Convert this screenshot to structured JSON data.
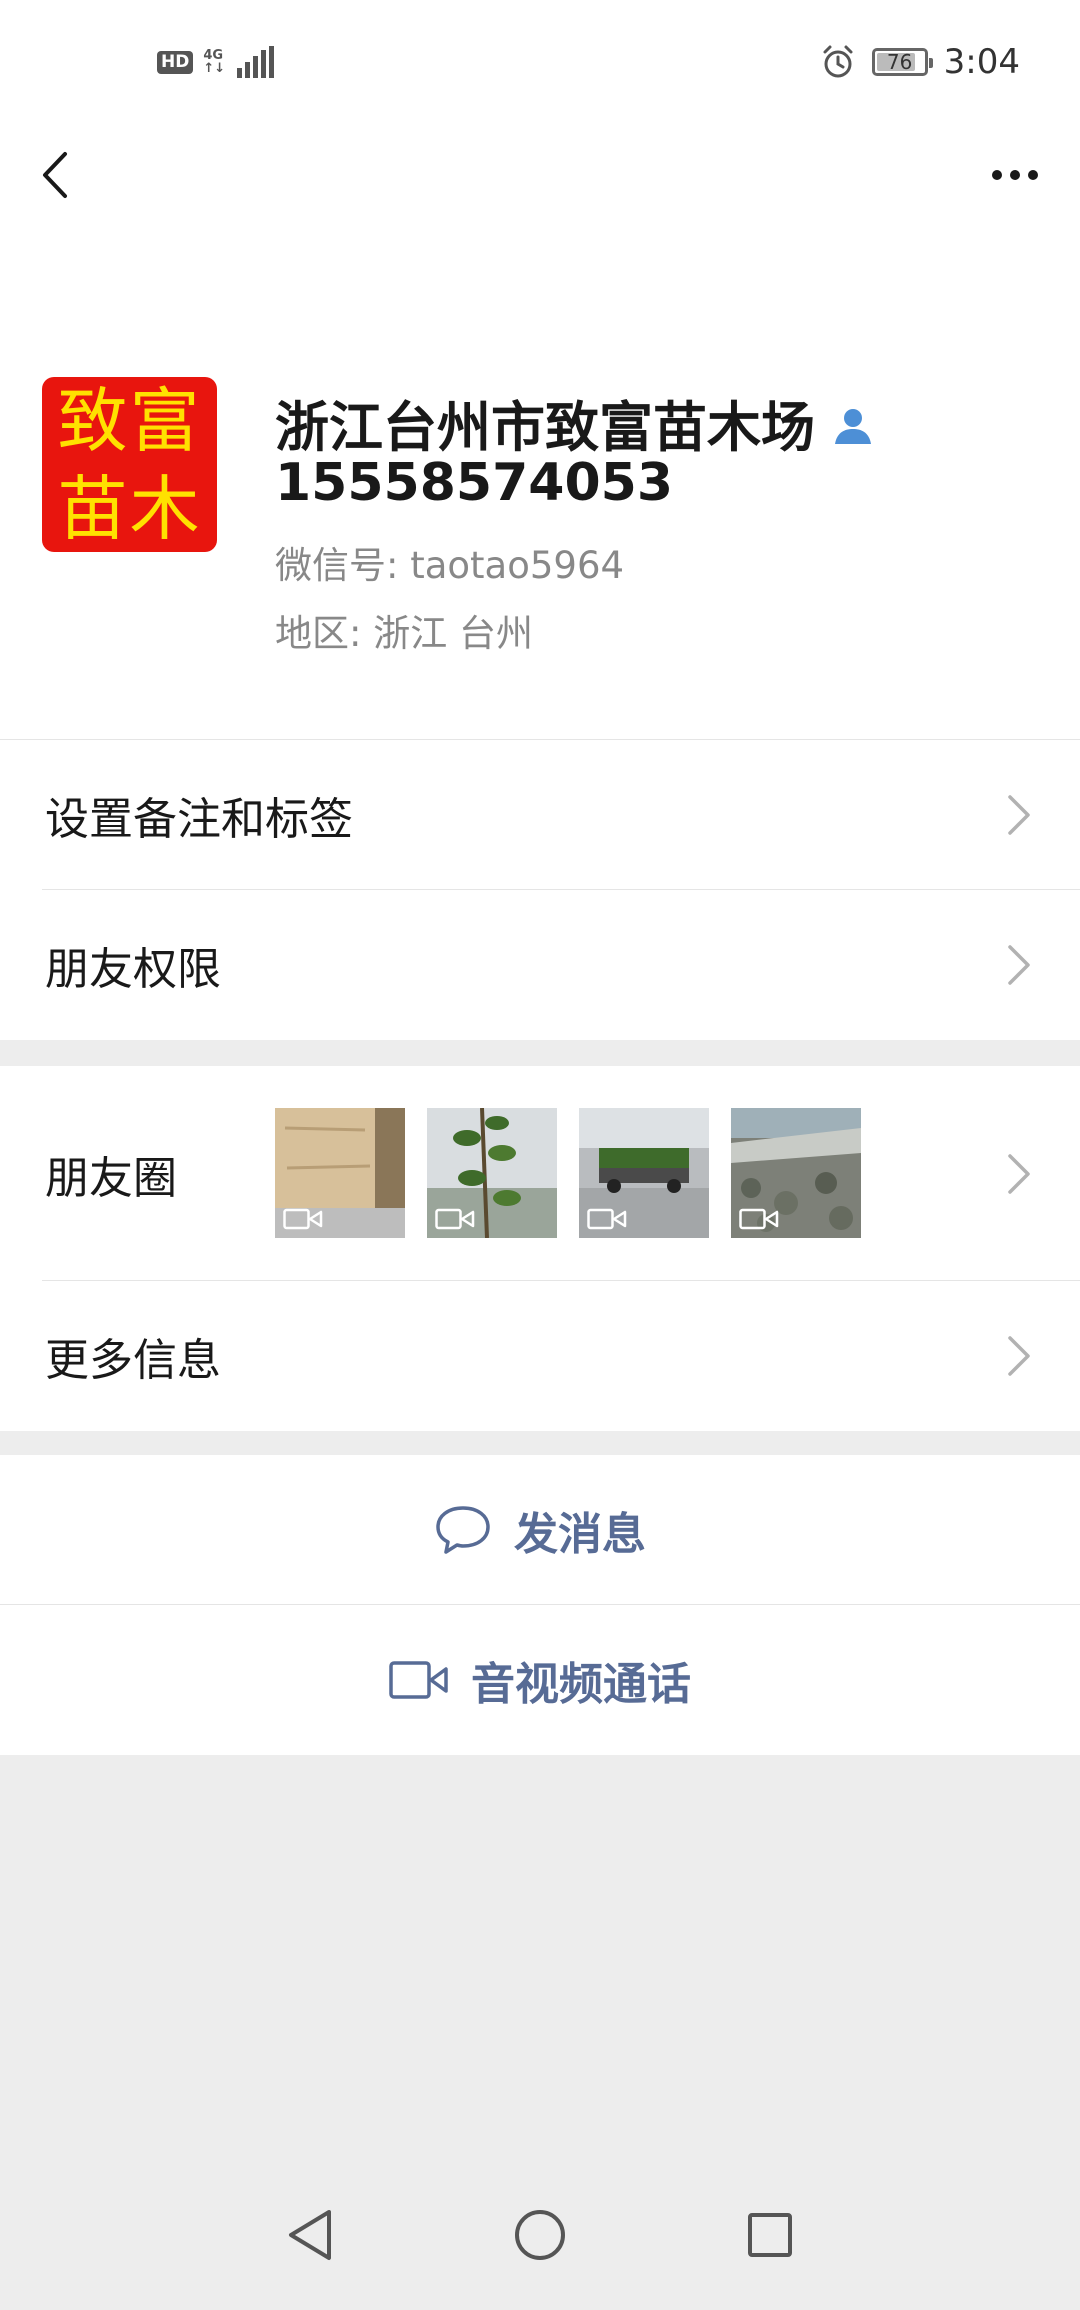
{
  "status_bar": {
    "hd": "HD",
    "network": "4G",
    "network_sub": "↑↓",
    "battery": "76",
    "time": "3:04",
    "icons": [
      "signal-icon",
      "alarm-icon",
      "battery-icon"
    ]
  },
  "header": {
    "icons": [
      "back-arrow-icon",
      "more-dots-icon"
    ]
  },
  "profile": {
    "avatar_line1": "致富",
    "avatar_line2": "苗木",
    "name": "浙江台州市致富苗木场",
    "phone": "15558574053",
    "wechat_id": "微信号: taotao5964",
    "region": "地区: 浙江  台州",
    "name_icon": "person-icon"
  },
  "menu": {
    "remark_label": "设置备注和标签",
    "permission_label": "朋友权限",
    "moments_label": "朋友圈",
    "more_info_label": "更多信息"
  },
  "moments_thumbs": [
    {
      "name": "thumb-wood-crate",
      "video": true
    },
    {
      "name": "thumb-plant-branch",
      "video": true
    },
    {
      "name": "thumb-truck",
      "video": true
    },
    {
      "name": "thumb-stone-wall",
      "video": true
    }
  ],
  "actions": {
    "message_label": "发消息",
    "call_label": "音视频通话"
  },
  "colors": {
    "link": "#576b95",
    "avatar_bg": "#e8150e",
    "avatar_text": "#ffe100",
    "verified": "#4d8fd6"
  }
}
